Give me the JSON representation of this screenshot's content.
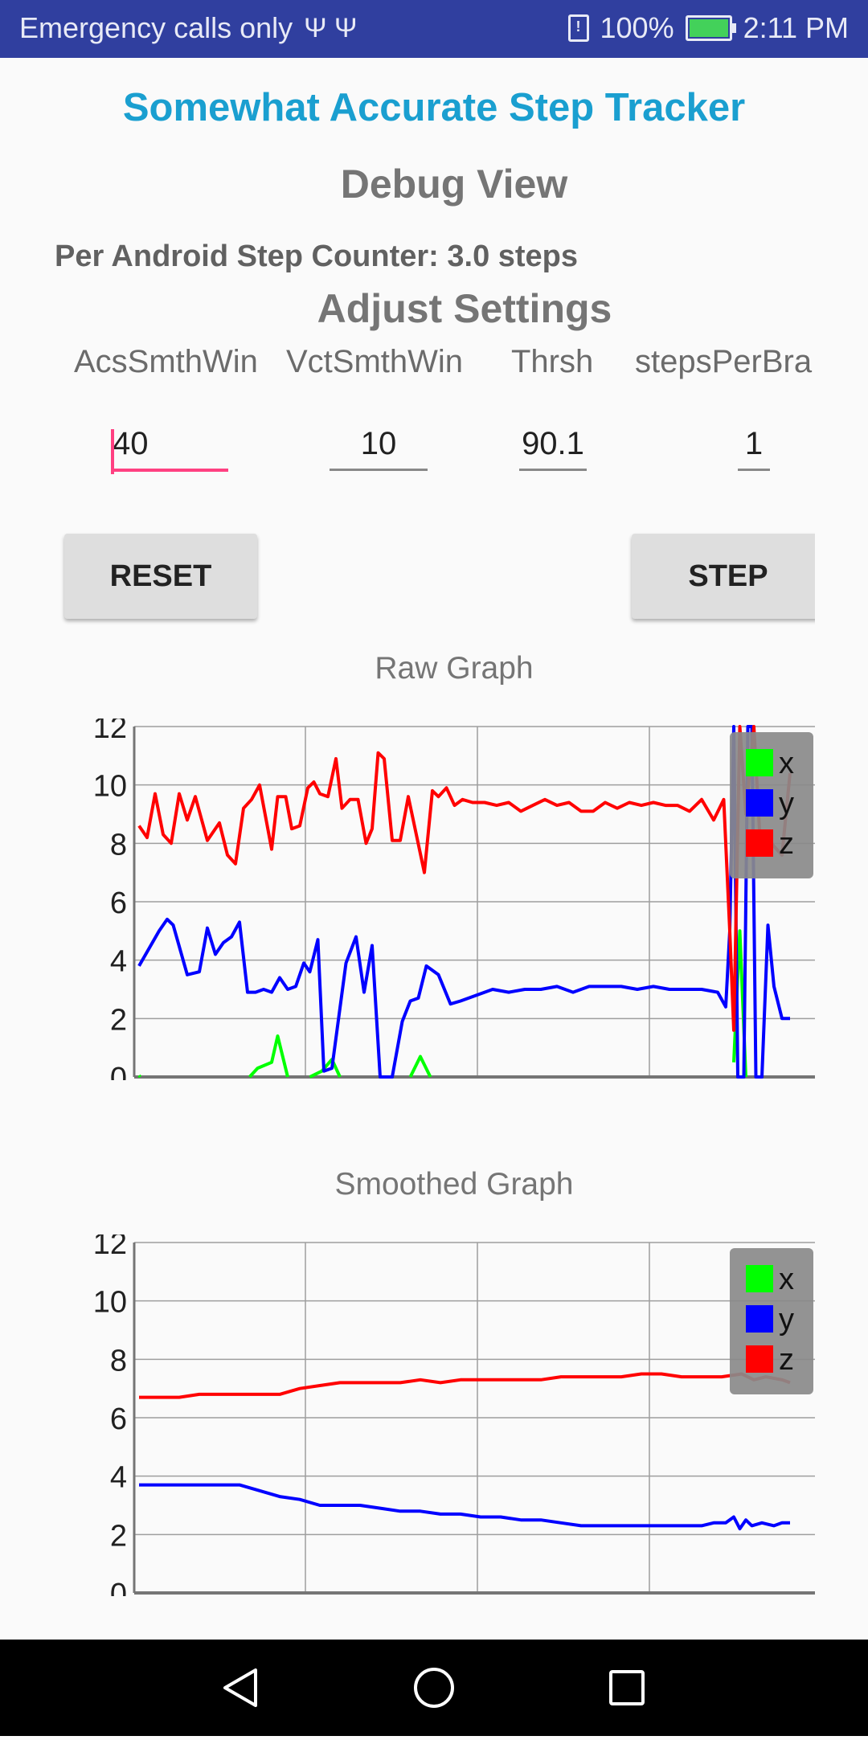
{
  "status_bar": {
    "carrier_text": "Emergency calls only",
    "usb_icons": "Ψ Ψ",
    "battery_percent": "100%",
    "time": "2:11 PM"
  },
  "app": {
    "title": "Somewhat Accurate Step Tracker",
    "debug_heading": "Debug View",
    "step_counter_text": "Per Android Step Counter: 3.0 steps",
    "settings_heading": "Adjust Settings"
  },
  "settings": [
    {
      "label": "AcsSmthWin",
      "value": "40"
    },
    {
      "label": "VctSmthWin",
      "value": "10"
    },
    {
      "label": "Thrsh",
      "value": "90.1"
    },
    {
      "label": "stepsPerBra",
      "value": "1"
    }
  ],
  "buttons": {
    "reset_label": "RESET",
    "step_label": "STEP"
  },
  "colors": {
    "x": "#00ff00",
    "y": "#0000ff",
    "z": "#ff0000",
    "title": "#1a9fd0",
    "status_bar": "#303f9f"
  },
  "chart_data": [
    {
      "type": "line",
      "title": "Raw Graph",
      "ylim": [
        0,
        12
      ],
      "y_ticks": [
        0,
        2,
        4,
        6,
        8,
        10,
        12
      ],
      "grid": true,
      "legend": "top-right",
      "series": [
        {
          "name": "x",
          "color": "#00ff00",
          "segments": [
            [
              [
                0,
                0.05
              ],
              [
                0.06,
                0.0
              ]
            ],
            [
              [
                5.5,
                0.0
              ],
              [
                5.9,
                0.3
              ],
              [
                6.6,
                0.5
              ],
              [
                6.9,
                1.4
              ],
              [
                7.4,
                0.0
              ]
            ],
            [
              [
                8.5,
                0.0
              ],
              [
                9.1,
                0.2
              ],
              [
                9.6,
                0.6
              ],
              [
                10.0,
                0.0
              ]
            ],
            [
              [
                13.5,
                0.0
              ],
              [
                14.0,
                0.7
              ],
              [
                14.5,
                0.0
              ]
            ],
            [
              [
                29.6,
                0.5
              ],
              [
                29.9,
                5.0
              ],
              [
                30.2,
                0.0
              ]
            ]
          ]
        },
        {
          "name": "y",
          "color": "#0000ff",
          "segments": [
            [
              [
                0,
                3.8
              ],
              [
                1.0,
                5.0
              ],
              [
                1.4,
                5.4
              ],
              [
                1.7,
                5.2
              ],
              [
                2.4,
                3.5
              ],
              [
                3.0,
                3.6
              ],
              [
                3.4,
                5.1
              ],
              [
                3.8,
                4.2
              ],
              [
                4.2,
                4.6
              ],
              [
                4.6,
                4.8
              ],
              [
                5.0,
                5.3
              ],
              [
                5.4,
                2.9
              ],
              [
                5.8,
                2.9
              ],
              [
                6.2,
                3.0
              ],
              [
                6.6,
                2.9
              ],
              [
                7.0,
                3.4
              ],
              [
                7.4,
                3.0
              ],
              [
                7.8,
                3.1
              ],
              [
                8.2,
                3.9
              ],
              [
                8.5,
                3.6
              ],
              [
                8.9,
                4.7
              ],
              [
                9.2,
                0.2
              ],
              [
                9.6,
                0.3
              ],
              [
                10.3,
                3.9
              ],
              [
                10.8,
                4.8
              ],
              [
                11.2,
                2.9
              ],
              [
                11.6,
                4.5
              ],
              [
                12.0,
                0.0
              ],
              [
                12.6,
                0.0
              ],
              [
                13.1,
                1.9
              ],
              [
                13.5,
                2.6
              ],
              [
                13.9,
                2.7
              ],
              [
                14.3,
                3.8
              ],
              [
                14.9,
                3.5
              ],
              [
                15.5,
                2.5
              ],
              [
                16.0,
                2.6
              ],
              [
                16.8,
                2.8
              ],
              [
                17.6,
                3.0
              ],
              [
                18.4,
                2.9
              ],
              [
                19.2,
                3.0
              ],
              [
                20.0,
                3.0
              ],
              [
                20.8,
                3.1
              ],
              [
                21.6,
                2.9
              ],
              [
                22.4,
                3.1
              ],
              [
                23.2,
                3.1
              ],
              [
                24.0,
                3.1
              ],
              [
                24.8,
                3.0
              ],
              [
                25.6,
                3.1
              ],
              [
                26.4,
                3.0
              ],
              [
                27.2,
                3.0
              ],
              [
                28.0,
                3.0
              ],
              [
                28.8,
                2.9
              ],
              [
                29.2,
                2.4
              ],
              [
                29.4,
                5.0
              ],
              [
                29.6,
                12.0
              ],
              [
                29.8,
                0.0
              ],
              [
                30.1,
                0.0
              ],
              [
                30.3,
                12.0
              ],
              [
                30.5,
                12.0
              ],
              [
                30.7,
                0.0
              ],
              [
                31.0,
                0.0
              ],
              [
                31.3,
                5.2
              ],
              [
                31.6,
                3.1
              ],
              [
                32.0,
                2.0
              ],
              [
                32.4,
                2.0
              ]
            ]
          ]
        },
        {
          "name": "z",
          "color": "#ff0000",
          "segments": [
            [
              [
                0,
                8.6
              ],
              [
                0.4,
                8.2
              ],
              [
                0.8,
                9.7
              ],
              [
                1.2,
                8.3
              ],
              [
                1.6,
                8.0
              ],
              [
                2.0,
                9.7
              ],
              [
                2.4,
                8.8
              ],
              [
                2.8,
                9.6
              ],
              [
                3.4,
                8.1
              ],
              [
                4.0,
                8.7
              ],
              [
                4.4,
                7.6
              ],
              [
                4.8,
                7.3
              ],
              [
                5.2,
                9.2
              ],
              [
                5.6,
                9.5
              ],
              [
                6.0,
                10.0
              ],
              [
                6.6,
                7.8
              ],
              [
                6.9,
                9.6
              ],
              [
                7.3,
                9.6
              ],
              [
                7.6,
                8.5
              ],
              [
                8.0,
                8.6
              ],
              [
                8.4,
                9.9
              ],
              [
                8.7,
                10.1
              ],
              [
                9.0,
                9.7
              ],
              [
                9.4,
                9.6
              ],
              [
                9.8,
                10.9
              ],
              [
                10.1,
                9.2
              ],
              [
                10.5,
                9.5
              ],
              [
                10.9,
                9.5
              ],
              [
                11.3,
                8.0
              ],
              [
                11.6,
                8.5
              ],
              [
                11.9,
                11.1
              ],
              [
                12.2,
                10.9
              ],
              [
                12.6,
                8.1
              ],
              [
                13.0,
                8.1
              ],
              [
                13.4,
                9.6
              ],
              [
                13.8,
                8.3
              ],
              [
                14.2,
                7.0
              ],
              [
                14.6,
                9.8
              ],
              [
                14.9,
                9.6
              ],
              [
                15.3,
                9.9
              ],
              [
                15.7,
                9.3
              ],
              [
                16.1,
                9.5
              ],
              [
                16.6,
                9.4
              ],
              [
                17.2,
                9.4
              ],
              [
                17.8,
                9.3
              ],
              [
                18.4,
                9.4
              ],
              [
                19.0,
                9.1
              ],
              [
                19.6,
                9.3
              ],
              [
                20.2,
                9.5
              ],
              [
                20.8,
                9.3
              ],
              [
                21.4,
                9.4
              ],
              [
                22.0,
                9.1
              ],
              [
                22.6,
                9.1
              ],
              [
                23.2,
                9.4
              ],
              [
                23.8,
                9.2
              ],
              [
                24.4,
                9.4
              ],
              [
                25.0,
                9.3
              ],
              [
                25.6,
                9.4
              ],
              [
                26.2,
                9.3
              ],
              [
                26.8,
                9.3
              ],
              [
                27.4,
                9.1
              ],
              [
                28.0,
                9.5
              ],
              [
                28.6,
                8.8
              ],
              [
                29.1,
                9.5
              ],
              [
                29.4,
                5.0
              ],
              [
                29.6,
                1.6
              ],
              [
                29.9,
                12.0
              ],
              [
                30.2,
                9.0
              ],
              [
                30.6,
                12.0
              ],
              [
                30.9,
                8.2
              ],
              [
                31.3,
                8.2
              ],
              [
                31.6,
                7.9
              ],
              [
                32.0,
                7.6
              ],
              [
                32.4,
                10.4
              ]
            ]
          ]
        }
      ]
    },
    {
      "type": "line",
      "title": "Smoothed Graph",
      "ylim": [
        0,
        12
      ],
      "y_ticks": [
        0,
        2,
        4,
        6,
        8,
        10,
        12
      ],
      "grid": true,
      "legend": "top-right",
      "series": [
        {
          "name": "x",
          "color": "#00ff00",
          "segments": []
        },
        {
          "name": "y",
          "color": "#0000ff",
          "segments": [
            [
              [
                0,
                3.7
              ],
              [
                1.0,
                3.7
              ],
              [
                2.0,
                3.7
              ],
              [
                3.0,
                3.7
              ],
              [
                4.0,
                3.7
              ],
              [
                5.0,
                3.7
              ],
              [
                6.0,
                3.5
              ],
              [
                7.0,
                3.3
              ],
              [
                8.0,
                3.2
              ],
              [
                9.0,
                3.0
              ],
              [
                10.0,
                3.0
              ],
              [
                11.0,
                3.0
              ],
              [
                12.0,
                2.9
              ],
              [
                13.0,
                2.8
              ],
              [
                14.0,
                2.8
              ],
              [
                15.0,
                2.7
              ],
              [
                16.0,
                2.7
              ],
              [
                17.0,
                2.6
              ],
              [
                18.0,
                2.6
              ],
              [
                19.0,
                2.5
              ],
              [
                20.0,
                2.5
              ],
              [
                21.0,
                2.4
              ],
              [
                22.0,
                2.3
              ],
              [
                23.0,
                2.3
              ],
              [
                24.0,
                2.3
              ],
              [
                25.0,
                2.3
              ],
              [
                26.0,
                2.3
              ],
              [
                27.0,
                2.3
              ],
              [
                28.0,
                2.3
              ],
              [
                28.6,
                2.4
              ],
              [
                29.2,
                2.4
              ],
              [
                29.6,
                2.6
              ],
              [
                29.9,
                2.2
              ],
              [
                30.2,
                2.5
              ],
              [
                30.5,
                2.3
              ],
              [
                31.0,
                2.4
              ],
              [
                31.6,
                2.3
              ],
              [
                32.0,
                2.4
              ],
              [
                32.4,
                2.4
              ]
            ]
          ]
        },
        {
          "name": "z",
          "color": "#ff0000",
          "segments": [
            [
              [
                0,
                6.7
              ],
              [
                1.0,
                6.7
              ],
              [
                2.0,
                6.7
              ],
              [
                3.0,
                6.8
              ],
              [
                4.0,
                6.8
              ],
              [
                5.0,
                6.8
              ],
              [
                6.0,
                6.8
              ],
              [
                7.0,
                6.8
              ],
              [
                8.0,
                7.0
              ],
              [
                9.0,
                7.1
              ],
              [
                10.0,
                7.2
              ],
              [
                11.0,
                7.2
              ],
              [
                12.0,
                7.2
              ],
              [
                13.0,
                7.2
              ],
              [
                14.0,
                7.3
              ],
              [
                15.0,
                7.2
              ],
              [
                16.0,
                7.3
              ],
              [
                17.0,
                7.3
              ],
              [
                18.0,
                7.3
              ],
              [
                19.0,
                7.3
              ],
              [
                20.0,
                7.3
              ],
              [
                21.0,
                7.4
              ],
              [
                22.0,
                7.4
              ],
              [
                23.0,
                7.4
              ],
              [
                24.0,
                7.4
              ],
              [
                25.0,
                7.5
              ],
              [
                26.0,
                7.5
              ],
              [
                27.0,
                7.4
              ],
              [
                28.0,
                7.4
              ],
              [
                29.0,
                7.4
              ],
              [
                30.0,
                7.5
              ],
              [
                30.6,
                7.3
              ],
              [
                31.2,
                7.4
              ],
              [
                32.0,
                7.3
              ],
              [
                32.4,
                7.2
              ]
            ]
          ]
        }
      ]
    }
  ]
}
